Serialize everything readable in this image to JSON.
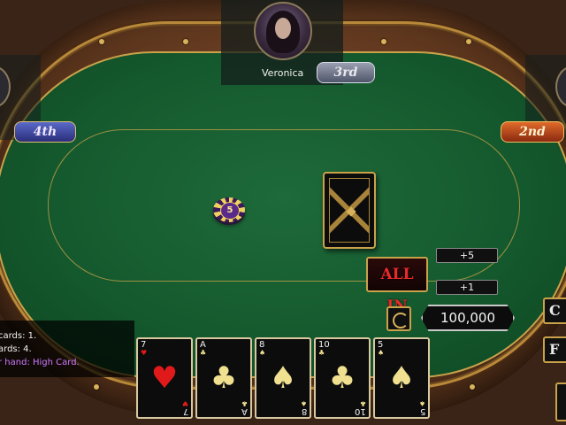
{
  "players": {
    "top": {
      "name": "Veronica",
      "rank": "3rd"
    },
    "left": {
      "rank": "4th"
    },
    "right": {
      "rank": "2nd"
    }
  },
  "pot": {
    "chip_label": "5"
  },
  "controls": {
    "all_in_label": "ALL IN",
    "plus5_label": "+5",
    "plus1_label": "+1",
    "bet_amount": "100,000",
    "right_button_1": "C",
    "right_button_2": "F"
  },
  "log": {
    "lines": [
      "cards: 1.",
      "ards: 4.",
      "r hand: High Card."
    ]
  },
  "hand": [
    {
      "rank": "7",
      "suit": "♥",
      "suit_name": "hearts",
      "color": "red"
    },
    {
      "rank": "A",
      "suit": "♣",
      "suit_name": "clubs",
      "color": "gold"
    },
    {
      "rank": "8",
      "suit": "♠",
      "suit_name": "spades",
      "color": "gold"
    },
    {
      "rank": "10",
      "suit": "♣",
      "suit_name": "clubs",
      "color": "gold"
    },
    {
      "rank": "5",
      "suit": "♠",
      "suit_name": "spades",
      "color": "gold"
    }
  ],
  "colors": {
    "felt": "#155a2e",
    "gold_trim": "#c9a24a",
    "wood": "#5a341c",
    "all_in_text": "#e82a2a",
    "hand_summary_text": "#d07aff"
  }
}
